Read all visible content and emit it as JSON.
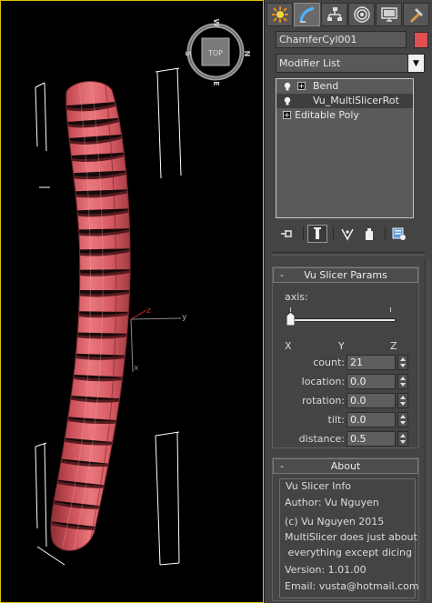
{
  "viewport": {
    "viewcube": {
      "face_label": "TOP",
      "compass": [
        "W",
        "N",
        "E",
        "S"
      ]
    },
    "gizmo_axes": [
      "z",
      "y",
      "x"
    ],
    "object_color": "#d9575e"
  },
  "command_panel": {
    "tabs": [
      "create-tab",
      "modify-tab",
      "hierarchy-tab",
      "motion-tab",
      "display-tab",
      "utilities-tab"
    ],
    "object_name": "ChamferCyl001",
    "object_color": "#e05050",
    "modifier_list_label": "Modifier List",
    "stack": [
      {
        "label": "Bend",
        "has_bulb": true,
        "has_expand": true
      },
      {
        "label": "Vu_MultiSlicerRot",
        "has_bulb": true,
        "has_expand": false
      },
      {
        "label": "Editable Poly",
        "has_bulb": false,
        "has_expand": true
      }
    ]
  },
  "slicer_params": {
    "title": "Vu Slicer Params",
    "axis_label": "axis:",
    "axis_letters": [
      "X",
      "Y",
      "Z"
    ],
    "params": [
      {
        "label": "count:",
        "value": "21"
      },
      {
        "label": "location:",
        "value": "0.0"
      },
      {
        "label": "rotation:",
        "value": "0.0"
      },
      {
        "label": "tilt:",
        "value": "0.0"
      },
      {
        "label": "distance:",
        "value": "0.5"
      }
    ]
  },
  "about": {
    "title": "About",
    "group_title": "Vu Slicer Info",
    "lines": [
      "Author: Vu Nguyen",
      "(c) Vu Nguyen 2015",
      "MultiSlicer does just about",
      " everything except dicing",
      "Version: 1.01.00",
      "Email: vusta@hotmail.com"
    ]
  }
}
